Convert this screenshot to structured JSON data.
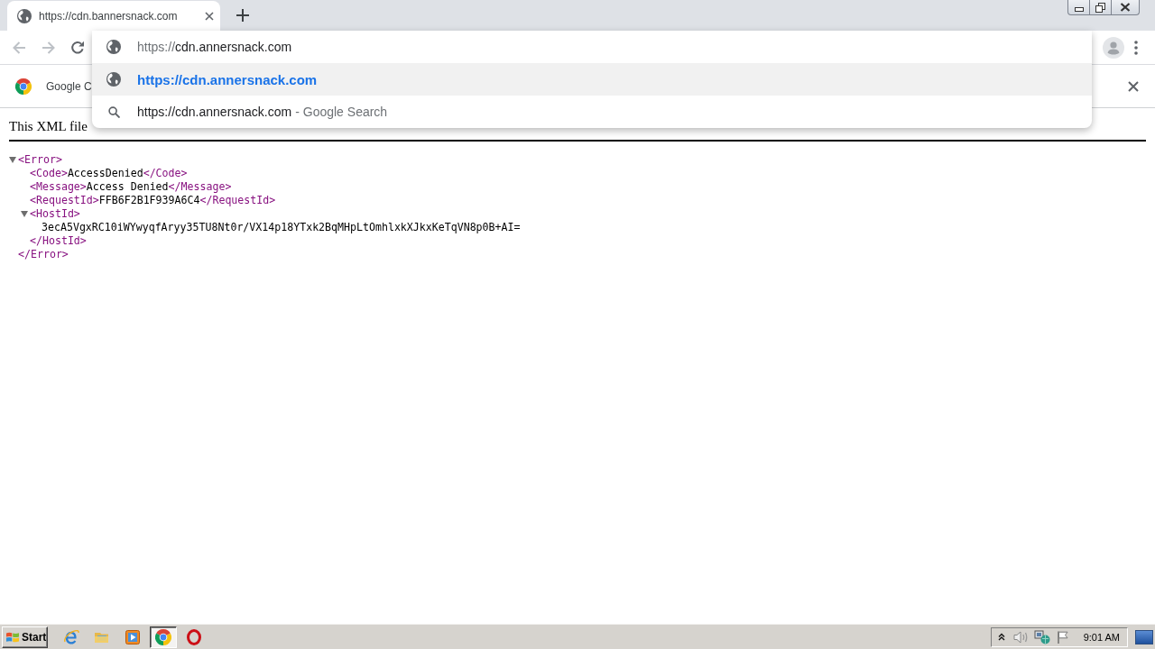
{
  "tabs": [
    {
      "title": "https://cdn.bannersnack.com",
      "selected": true
    }
  ],
  "toolbar": {
    "back": {
      "disabled": true
    },
    "forward": {
      "disabled": true
    },
    "reload": {
      "disabled": false
    }
  },
  "omnibox": {
    "scheme": "https://",
    "host": "cdn.annersnack.com",
    "suggestions": [
      {
        "kind": "url",
        "text": "https://cdn.annersnack.com",
        "selected": true
      },
      {
        "kind": "search",
        "text": "https://cdn.annersnack.com",
        "description": "- Google Search",
        "selected": false
      }
    ]
  },
  "infobar": {
    "text": "Google C"
  },
  "xml_viewer": {
    "notice": "This XML file",
    "nodes": [
      {
        "kind": "parent",
        "open": "<Error>",
        "close": "</Error>",
        "expanded": true,
        "children": [
          {
            "kind": "element",
            "open": "<Code>",
            "text": "AccessDenied",
            "close": "</Code>"
          },
          {
            "kind": "element",
            "open": "<Message>",
            "text": "Access Denied",
            "close": "</Message>"
          },
          {
            "kind": "element",
            "open": "<RequestId>",
            "text": "FFB6F2B1F939A6C4",
            "close": "</RequestId>"
          },
          {
            "kind": "parent",
            "open": "<HostId>",
            "close": "</HostId>",
            "expanded": true,
            "children": [
              {
                "kind": "text",
                "text": "3ecA5VgxRC10iWYwyqfAryy35TU8Nt0r/VX14p18YTxk2BqMHpLtOmhlxkXJkxKeTqVN8p0B+AI="
              }
            ]
          }
        ]
      }
    ]
  },
  "taskbar": {
    "start": "Start",
    "apps": [
      {
        "kind": "e-globe",
        "selected": false
      },
      {
        "kind": "folder",
        "selected": false
      },
      {
        "kind": "play",
        "selected": false
      },
      {
        "kind": "color-ring",
        "selected": true
      },
      {
        "kind": "ring-o",
        "selected": false
      }
    ],
    "clock": "9:01 AM"
  }
}
